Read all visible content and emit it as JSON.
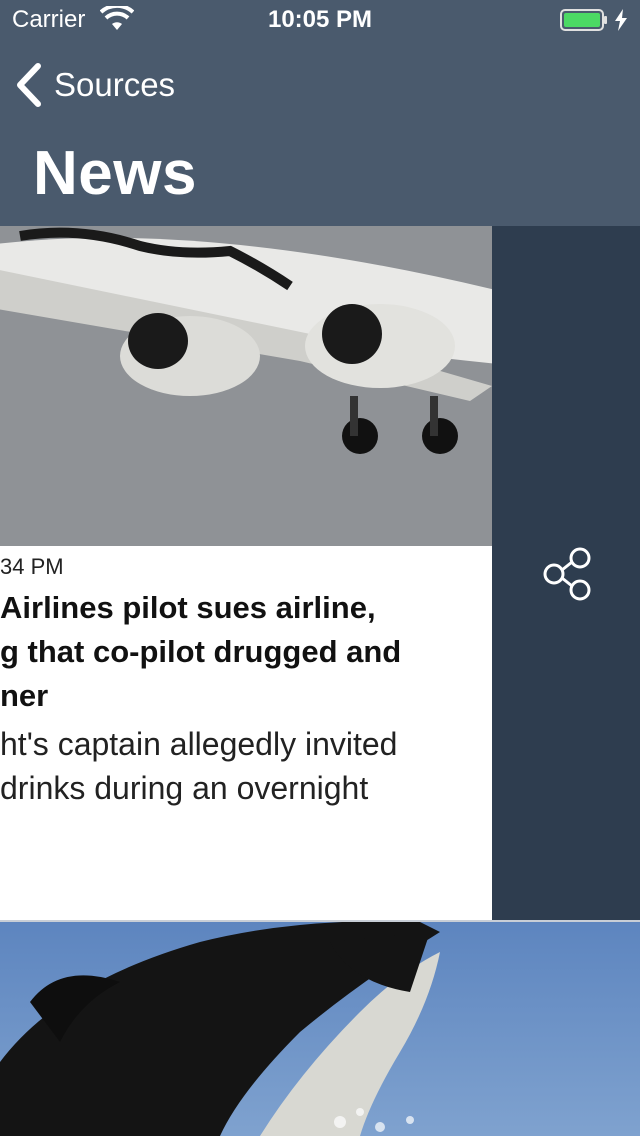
{
  "status_bar": {
    "carrier": "Carrier",
    "time": "10:05 PM",
    "battery_color": "#4cd964"
  },
  "nav": {
    "back_label": "Sources",
    "title": "News",
    "bar_color": "#4a5a6d"
  },
  "article": {
    "timestamp": "34 PM",
    "headline_lines": [
      "Airlines pilot sues airline,",
      "g that co-pilot drugged and",
      "ner"
    ],
    "summary_lines": [
      "ht's captain allegedly invited",
      "drinks during an overnight"
    ],
    "image": "airplane-photo"
  },
  "actions": {
    "share_icon": "share-icon",
    "panel_color": "#2e3d4f"
  },
  "next_article": {
    "image": "orca-photo"
  }
}
